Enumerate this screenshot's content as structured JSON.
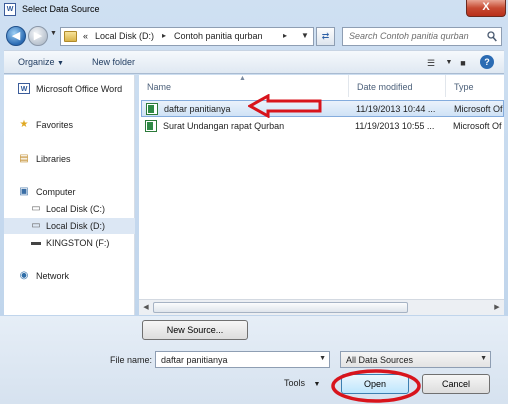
{
  "window": {
    "title": "Select Data Source",
    "close_label": "X"
  },
  "address": {
    "prefix": "«",
    "parts": [
      "Local Disk (D:)",
      "Contoh panitia qurban"
    ],
    "search_placeholder": "Search Contoh panitia qurban"
  },
  "toolbar": {
    "organize": "Organize",
    "new_folder": "New folder"
  },
  "sidebar": {
    "items": [
      {
        "label": "Microsoft Office Word",
        "icon": "word-icon"
      },
      {
        "label": "Favorites",
        "icon": "star-icon"
      },
      {
        "label": "Libraries",
        "icon": "libraries-icon"
      },
      {
        "label": "Computer",
        "icon": "computer-icon"
      },
      {
        "label": "Local Disk (C:)",
        "icon": "drive-icon"
      },
      {
        "label": "Local Disk (D:)",
        "icon": "drive-icon"
      },
      {
        "label": "KINGSTON (F:)",
        "icon": "usb-drive-icon"
      },
      {
        "label": "Network",
        "icon": "network-icon"
      }
    ]
  },
  "files": {
    "columns": [
      "Name",
      "Date modified",
      "Type"
    ],
    "rows": [
      {
        "name": "daftar panitianya",
        "date": "11/19/2013 10:44 ...",
        "type": "Microsoft Of"
      },
      {
        "name": "Surat Undangan rapat Qurban",
        "date": "11/19/2013 10:55 ...",
        "type": "Microsoft Of"
      }
    ]
  },
  "footer": {
    "new_source": "New Source...",
    "file_name_label": "File name:",
    "file_name_value": "daftar panitianya",
    "filter_value": "All Data Sources",
    "tools": "Tools",
    "open": "Open",
    "cancel": "Cancel"
  },
  "annotations": {
    "color": "#d8141c"
  }
}
